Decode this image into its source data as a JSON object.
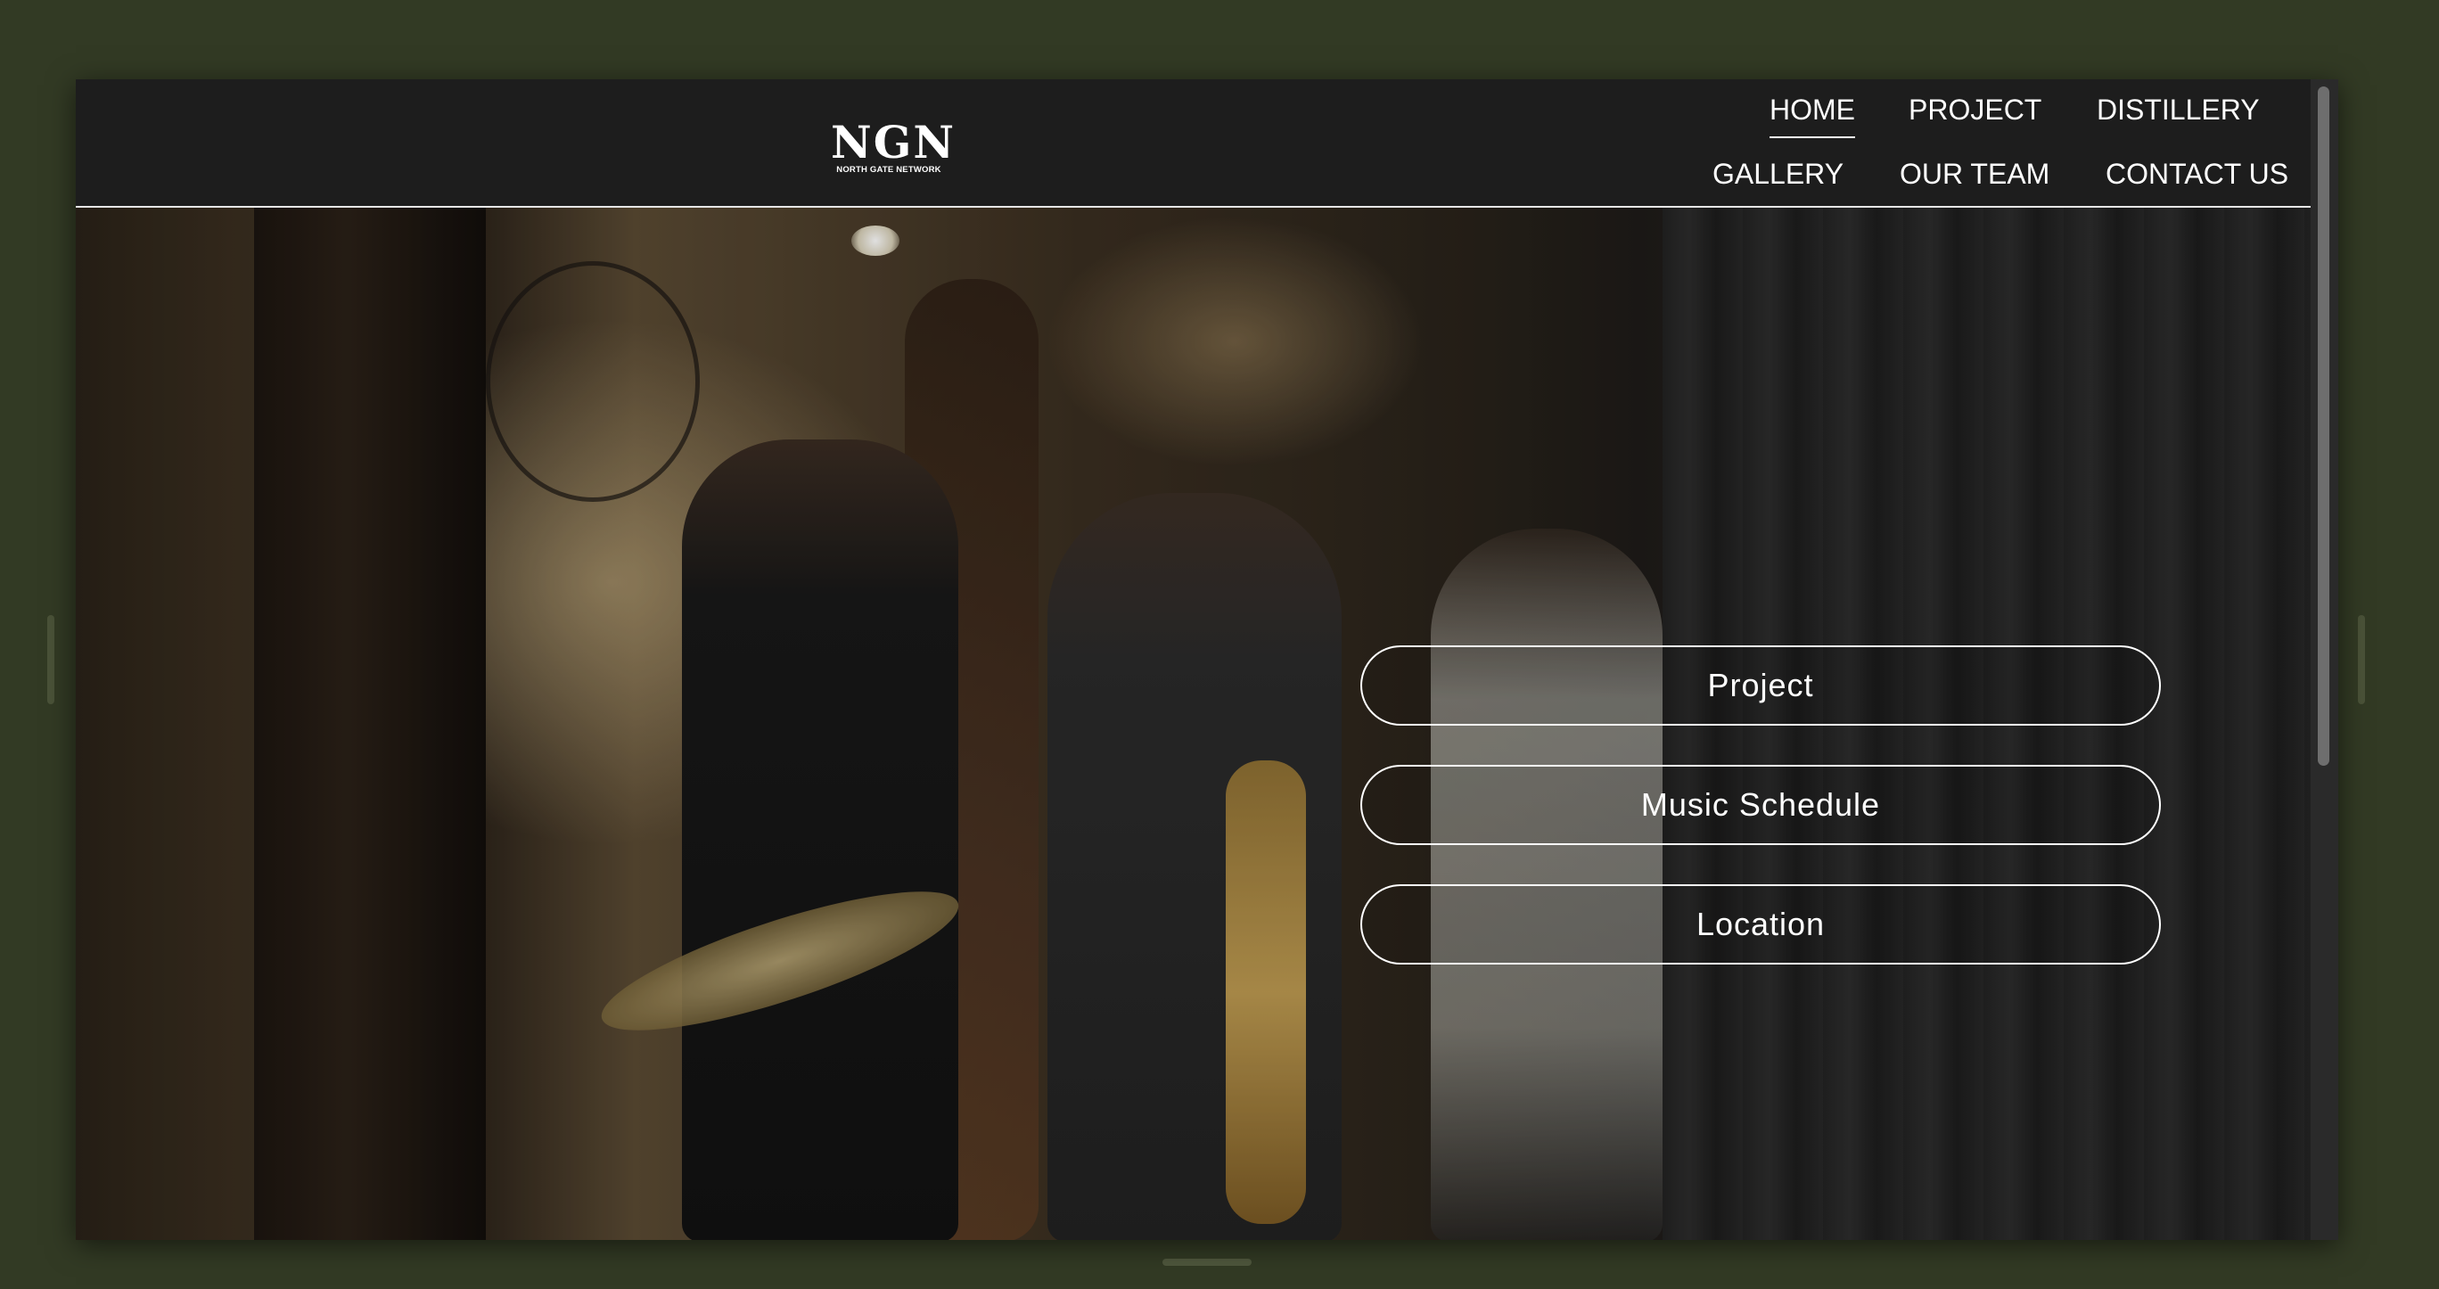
{
  "logo": {
    "mark": "NGN",
    "subtitle": "NORTH GATE NETWORK"
  },
  "nav": {
    "home": "HOME",
    "project": "PROJECT",
    "distillery": "DISTILLERY",
    "gallery": "GALLERY",
    "our_team": "OUR TEAM",
    "contact_us": "CONTACT US",
    "active": "HOME"
  },
  "hero": {
    "buttons": {
      "project": "Project",
      "music_schedule": "Music Schedule",
      "location": "Location"
    }
  },
  "colors": {
    "desktop_background": "#323a24",
    "header_background": "#1d1d1d",
    "text": "#ffffff"
  }
}
